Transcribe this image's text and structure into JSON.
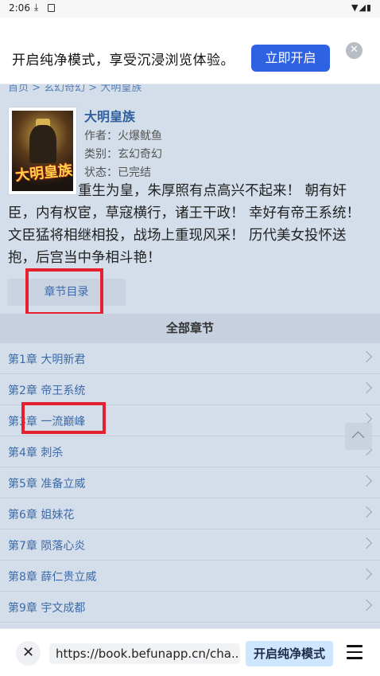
{
  "status_bar": {
    "time": "2:06"
  },
  "banner": {
    "message": "开启纯净模式，享受沉浸浏览体验。",
    "open_button": "立即开启"
  },
  "breadcrumb": "首页 > 玄幻奇幻 > 大明皇族",
  "book": {
    "title": "大明皇族",
    "author": "作者：火爆鱿鱼",
    "category": "类别：玄幻奇幻",
    "status": "状态：已完结",
    "cover_art_title": "大明皇族",
    "description": "重生为皇，朱厚照有点高兴不起来！ 朝有奸臣，内有权宦，草寇横行，诸王干政！ 幸好有帝王系统！ 文臣猛将相继相投，战场上重现风采！ 历代美女投怀送抱，后宫当中争相斗艳！"
  },
  "toc_button": "章节目录",
  "section_title": "全部章节",
  "chapters": [
    "第1章 大明新君",
    "第2章 帝王系统",
    "第3章 一流巅峰",
    "第4章 刺杀",
    "第5章 准备立威",
    "第6章 姐妹花",
    "第7章 陨落心炎",
    "第8章 薛仁贵立威",
    "第9章 宇文成都"
  ],
  "bottom_bar": {
    "url": "https://book.befunapp.cn/cha...",
    "pure_mode_button": "开启纯净模式"
  },
  "colors": {
    "accent": "#2f62e3",
    "page_bg": "#d4deea",
    "link": "#3c6aa8",
    "highlight": "#e5212f"
  }
}
